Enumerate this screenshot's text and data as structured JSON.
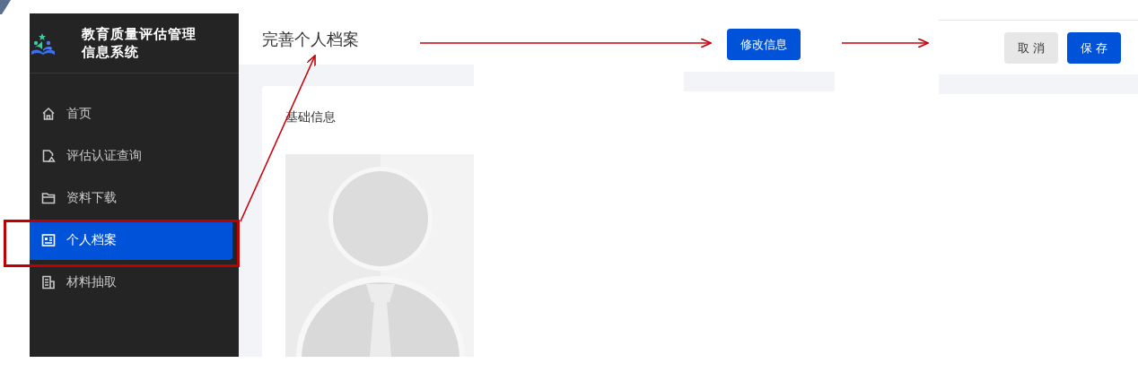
{
  "sidebar": {
    "title": "教育质量评估管理信息系统",
    "items": [
      {
        "label": "首页",
        "selected": false
      },
      {
        "label": "评估认证查询",
        "selected": false
      },
      {
        "label": "资料下载",
        "selected": false
      },
      {
        "label": "个人档案",
        "selected": true
      },
      {
        "label": "材料抽取",
        "selected": false
      }
    ]
  },
  "page": {
    "title": "完善个人档案",
    "section_title": "基础信息"
  },
  "edit_button": "修改信息",
  "dialog_buttons": [
    {
      "label": "取 消",
      "kind": "secondary"
    },
    {
      "label": "保 存",
      "kind": "primary"
    }
  ]
}
